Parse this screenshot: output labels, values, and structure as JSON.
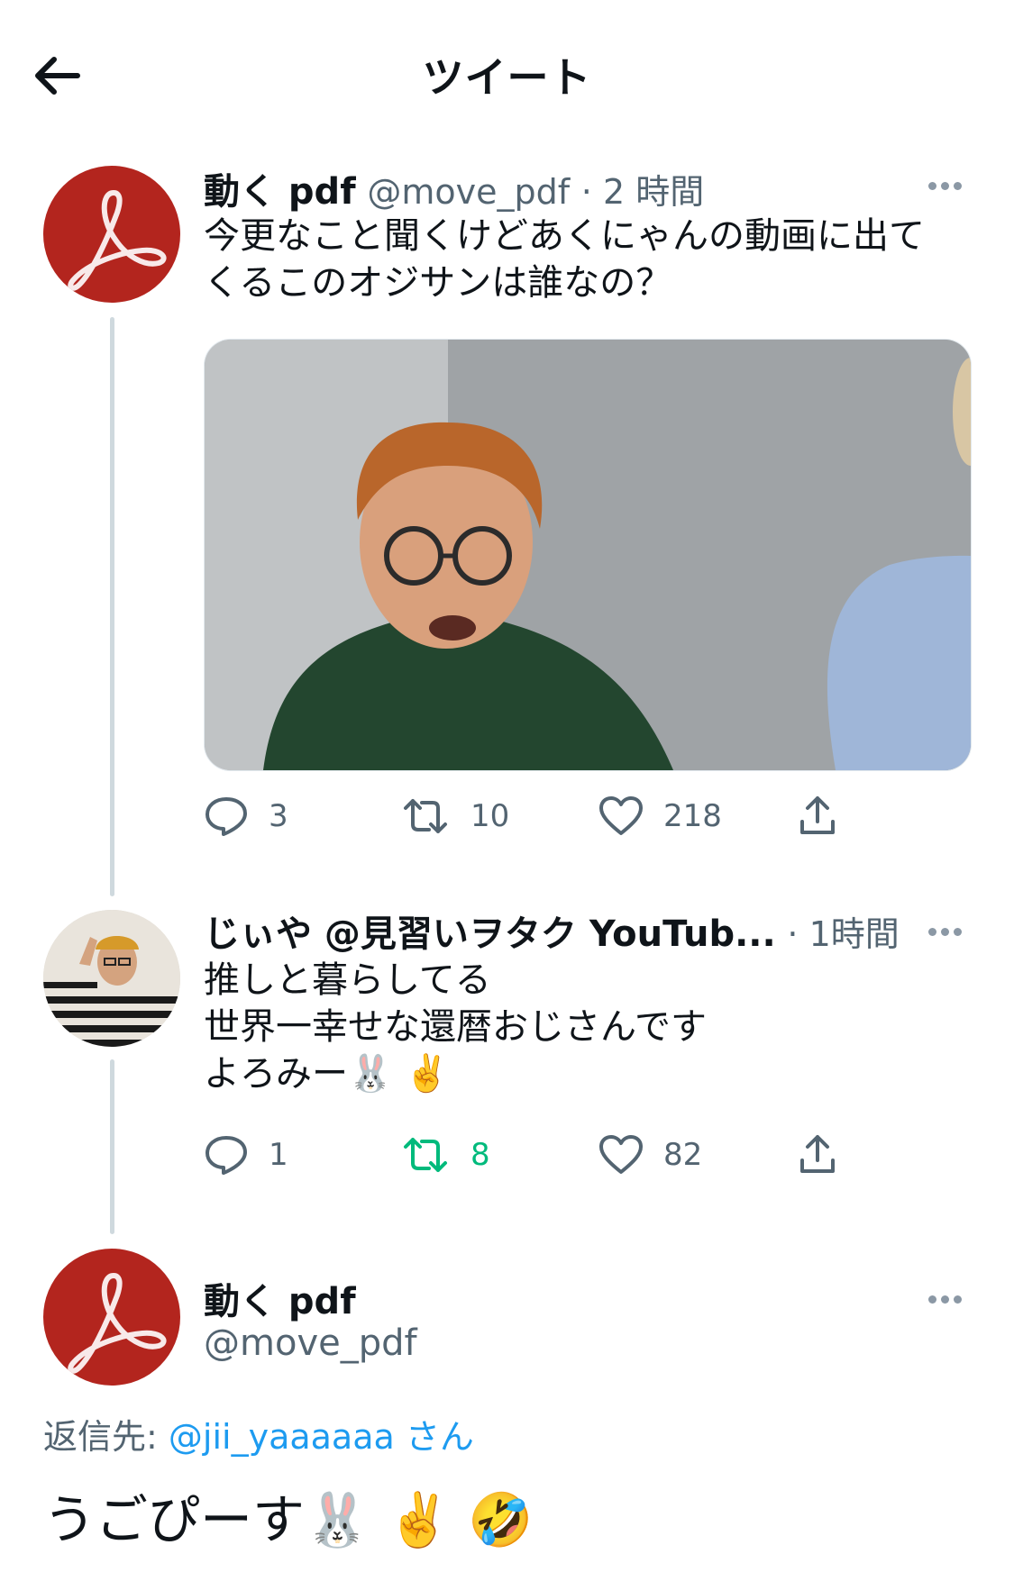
{
  "header": {
    "title": "ツイート"
  },
  "tweet1": {
    "name": "動く pdf",
    "handle": "@move_pdf",
    "time": "· 2 時間",
    "text": "今更なこと聞くけどあくにゃんの動画に出て\nくるこのオジサンは誰なの？",
    "actions": {
      "reply": "3",
      "retweet": "10",
      "like": "218"
    }
  },
  "tweet2": {
    "name": "じぃや @見習いヲタク YouTub...",
    "time": "· 1時間",
    "text": "推しと暮らしてる\n世界一幸せな還暦おじさんです\nよろみー🐰 ✌️",
    "actions": {
      "reply": "1",
      "retweet": "8",
      "like": "82"
    }
  },
  "main_tweet": {
    "name": "動く pdf",
    "handle": "@move_pdf",
    "reply_prefix": "返信先:",
    "reply_mention": "@jii_yaaaaaa",
    "reply_suffix": "さん",
    "text": "うごぴーす🐰 ✌️ 🤣"
  },
  "colors": {
    "accent": "#1d9bf0",
    "retweet_active": "#00ba7c",
    "avatar_red": "#b3251e",
    "muted": "#536471"
  }
}
